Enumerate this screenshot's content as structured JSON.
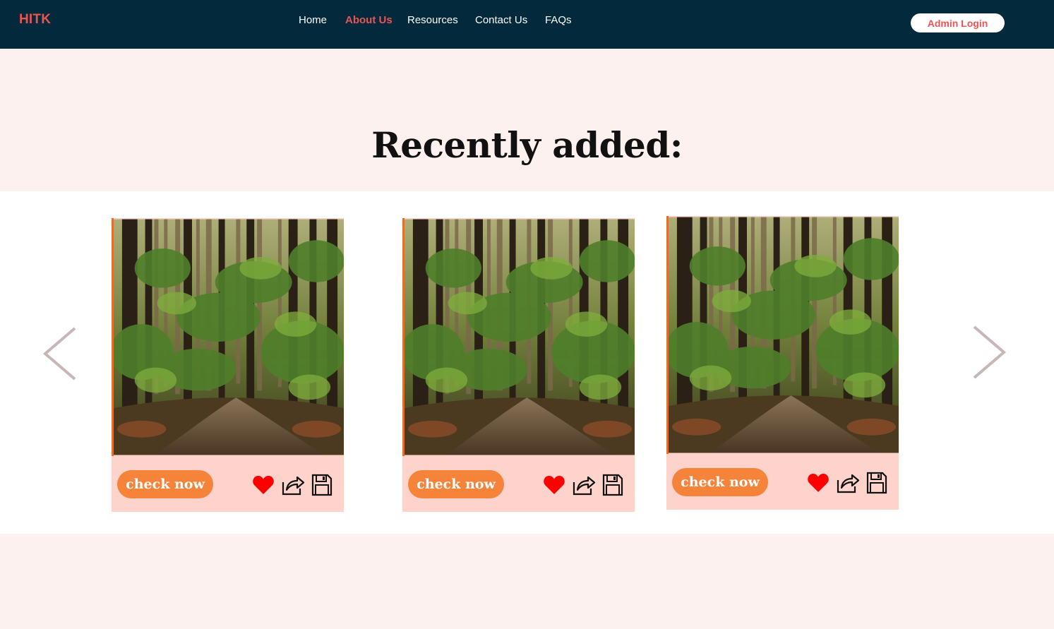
{
  "header": {
    "brand": "HITK",
    "nav": [
      {
        "label": "Home",
        "active": false
      },
      {
        "label": "About Us",
        "active": true
      },
      {
        "label": "Resources",
        "active": false
      },
      {
        "label": "Contact Us",
        "active": false
      },
      {
        "label": "FAQs",
        "active": false
      }
    ],
    "admin_login_label": "Admin Login"
  },
  "section": {
    "title": "Recently added:"
  },
  "carousel": {
    "prev_icon": "chevron-left-icon",
    "next_icon": "chevron-right-icon",
    "cards": [
      {
        "image": "forest-path-photo",
        "button_label": "check now",
        "icons": [
          "heart-icon",
          "share-icon",
          "save-icon"
        ]
      },
      {
        "image": "forest-path-photo",
        "button_label": "check now",
        "icons": [
          "heart-icon",
          "share-icon",
          "save-icon"
        ]
      },
      {
        "image": "forest-path-photo",
        "button_label": "check now",
        "icons": [
          "heart-icon",
          "share-icon",
          "save-icon"
        ]
      }
    ]
  },
  "colors": {
    "navbar": "#022a3c",
    "accent_red": "#ec5353",
    "page_bg": "#fcf1ef",
    "card_bg": "#fdd3cb",
    "button_orange": "#f5843a",
    "heart_red": "#ff0000",
    "arrow_gray": "#c9b6b6"
  }
}
